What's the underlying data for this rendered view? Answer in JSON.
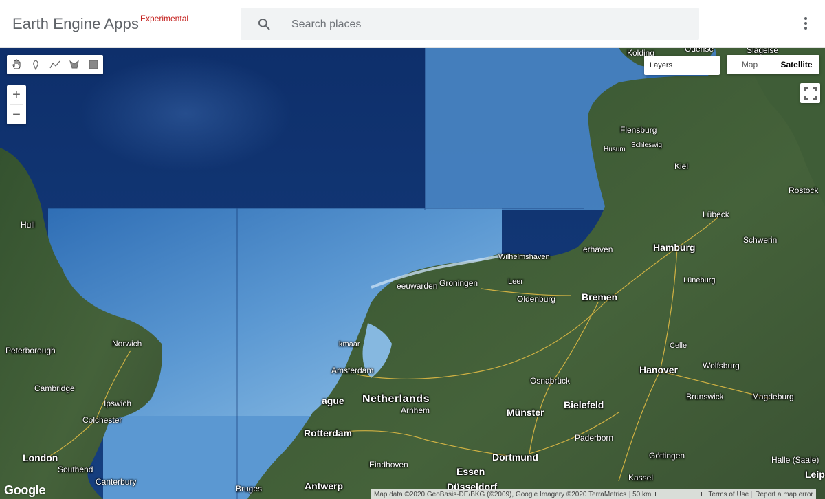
{
  "header": {
    "app_title": "Earth Engine Apps",
    "badge": "Experimental",
    "search_placeholder": "Search places",
    "menu_icon": "more-vert-icon"
  },
  "colors": {
    "sea_deep": "#0e2f6b",
    "sea_shallow": "#6fa6d8",
    "land": "#3b5a36",
    "roads": "#f0c040",
    "badge_red": "#c5221f"
  },
  "map": {
    "draw_tools": [
      {
        "name": "hand-icon"
      },
      {
        "name": "marker-icon"
      },
      {
        "name": "polyline-icon"
      },
      {
        "name": "polygon-icon"
      },
      {
        "name": "rectangle-icon"
      }
    ],
    "zoom_in": "+",
    "zoom_out": "−",
    "layers_label": "Layers",
    "map_types": [
      {
        "label": "Map",
        "active": false
      },
      {
        "label": "Satellite",
        "active": true
      }
    ],
    "places": [
      {
        "label": "Kolding"
      },
      {
        "label": "Odense"
      },
      {
        "label": "Slagelse"
      },
      {
        "label": "Flensburg"
      },
      {
        "label": "Husum"
      },
      {
        "label": "Schleswig"
      },
      {
        "label": "Kiel"
      },
      {
        "label": "Rostock"
      },
      {
        "label": "Hull"
      },
      {
        "label": "Lübeck"
      },
      {
        "label": "erhaven"
      },
      {
        "label": "Hamburg"
      },
      {
        "label": "Schwerin"
      },
      {
        "label": "Wilhelmshaven"
      },
      {
        "label": "eeuwarden"
      },
      {
        "label": "Groningen"
      },
      {
        "label": "Leer"
      },
      {
        "label": "Lüneburg"
      },
      {
        "label": "Oldenburg"
      },
      {
        "label": "Bremen"
      },
      {
        "label": "Norwich"
      },
      {
        "label": "Peterborough"
      },
      {
        "label": "kmaar"
      },
      {
        "label": "Celle"
      },
      {
        "label": "Amsterdam"
      },
      {
        "label": "Hanover"
      },
      {
        "label": "Wolfsburg"
      },
      {
        "label": "Cambridge"
      },
      {
        "label": "Osnabrück"
      },
      {
        "label": "Ipswich"
      },
      {
        "label": "ague"
      },
      {
        "label": "Netherlands"
      },
      {
        "label": "Brunswick"
      },
      {
        "label": "Magdeburg"
      },
      {
        "label": "Colchester"
      },
      {
        "label": "Arnhem"
      },
      {
        "label": "Bielefeld"
      },
      {
        "label": "Münster"
      },
      {
        "label": "Rotterdam"
      },
      {
        "label": "Paderborn"
      },
      {
        "label": "London"
      },
      {
        "label": "Dortmund"
      },
      {
        "label": "Göttingen"
      },
      {
        "label": "Halle (Saale)"
      },
      {
        "label": "Eindhoven"
      },
      {
        "label": "Southend"
      },
      {
        "label": "Essen"
      },
      {
        "label": "Canterbury"
      },
      {
        "label": "Kassel"
      },
      {
        "label": "Leip"
      },
      {
        "label": "Bruges"
      },
      {
        "label": "Antwerp"
      },
      {
        "label": "Düsseldorf"
      }
    ]
  },
  "footer": {
    "logo": "Google",
    "map_data": "Map data ©2020 GeoBasis-DE/BKG (©2009), Google Imagery ©2020 TerraMetrics",
    "scale_label": "50 km",
    "terms": "Terms of Use",
    "report": "Report a map error"
  }
}
